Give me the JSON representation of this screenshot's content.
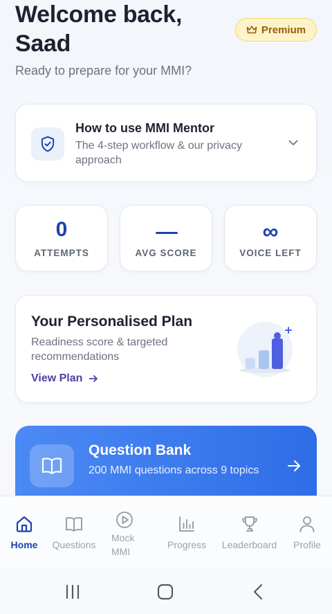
{
  "header": {
    "welcome": "Welcome back, Saad",
    "subtitle": "Ready to prepare for your MMI?",
    "badge_icon": "crown-icon",
    "badge_label": "Premium"
  },
  "howto": {
    "icon": "shield-check-icon",
    "title": "How to use MMI Mentor",
    "description": "The 4-step workflow & our privacy approach",
    "toggle_icon": "chevron-down-icon"
  },
  "stats": [
    {
      "value": "0",
      "label": "ATTEMPTS"
    },
    {
      "value": "—",
      "label": "AVG SCORE"
    },
    {
      "value": "∞",
      "label": "VOICE LEFT"
    }
  ],
  "plan": {
    "title": "Your Personalised Plan",
    "description": "Readiness score & targeted recommendations",
    "link_label": "View Plan",
    "illustration": "bar-chart-growth-illustration"
  },
  "question_bank": {
    "icon": "open-book-icon",
    "title": "Question Bank",
    "description": "200 MMI questions across 9 topics",
    "arrow_icon": "arrow-right-icon"
  },
  "tabs": [
    {
      "label": "Home",
      "icon": "home-icon",
      "active": true
    },
    {
      "label": "Questions",
      "icon": "book-icon",
      "active": false
    },
    {
      "label": "Mock MMI",
      "icon": "play-circle-icon",
      "active": false
    },
    {
      "label": "Progress",
      "icon": "bar-chart-icon",
      "active": false
    },
    {
      "label": "Leaderboard",
      "icon": "trophy-icon",
      "active": false
    },
    {
      "label": "Profile",
      "icon": "user-icon",
      "active": false
    }
  ],
  "colors": {
    "accent": "#1e40af",
    "premium_bg": "#fdf3c8",
    "premium_text": "#9a5b0c",
    "question_bank_start": "#4b8af4",
    "question_bank_end": "#2f6de8",
    "tab_inactive": "#9aa1ac"
  },
  "system_nav": [
    "recents-icon",
    "home-circle-icon",
    "back-icon"
  ]
}
